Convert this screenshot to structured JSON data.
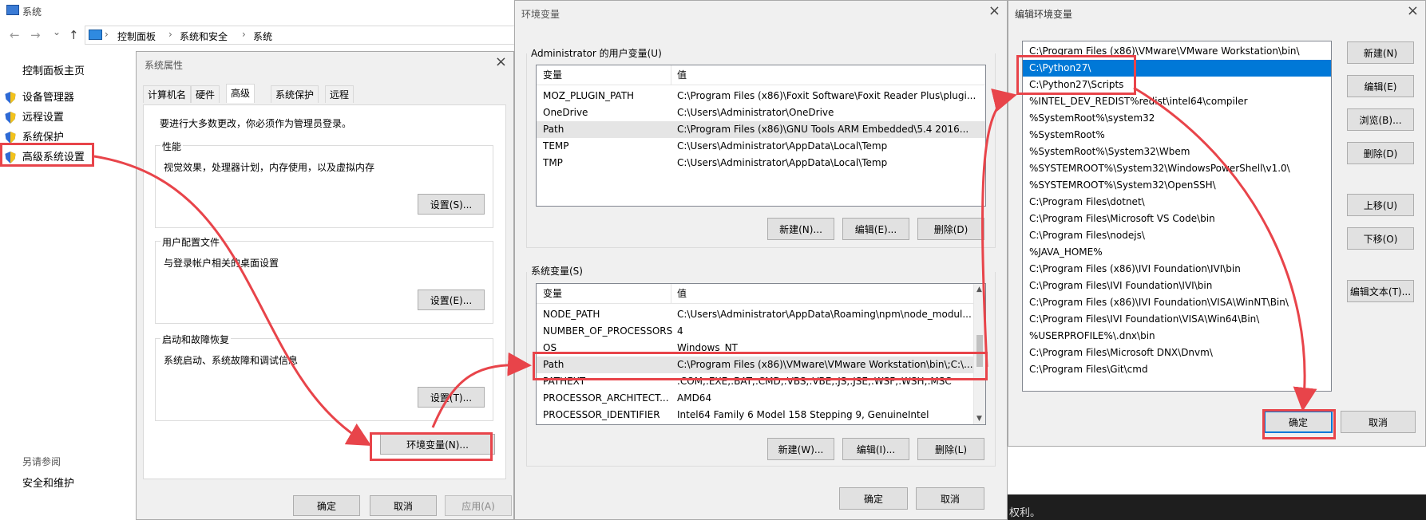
{
  "system_window": {
    "title": "系统",
    "breadcrumb": [
      "控制面板",
      "系统和安全",
      "系统"
    ],
    "nav_back": "←",
    "nav_forward": "→",
    "nav_dropdown": "⌄",
    "nav_up": "↑",
    "sidebar_home": "控制面板主页",
    "sidebar_items": [
      "设备管理器",
      "远程设置",
      "系统保护",
      "高级系统设置"
    ],
    "see_also_label": "另请参阅",
    "see_also_items": [
      "安全和维护"
    ]
  },
  "sys_props": {
    "title": "系统属性",
    "tabs": [
      "计算机名",
      "硬件",
      "高级",
      "系统保护",
      "远程"
    ],
    "active_tab": "高级",
    "admin_note": "要进行大多数更改，你必须作为管理员登录。",
    "groups": [
      {
        "label": "性能",
        "desc": "视觉效果，处理器计划，内存使用，以及虚拟内存",
        "button": "设置(S)..."
      },
      {
        "label": "用户配置文件",
        "desc": "与登录帐户相关的桌面设置",
        "button": "设置(E)..."
      },
      {
        "label": "启动和故障恢复",
        "desc": "系统启动、系统故障和调试信息",
        "button": "设置(T)..."
      }
    ],
    "env_button": "环境变量(N)...",
    "ok": "确定",
    "cancel": "取消",
    "apply": "应用(A)"
  },
  "env_vars": {
    "title": "环境变量",
    "user_section": "Administrator 的用户变量(U)",
    "col_var": "变量",
    "col_value": "值",
    "user_rows": [
      {
        "name": "MOZ_PLUGIN_PATH",
        "value": "C:\\Program Files (x86)\\Foxit Software\\Foxit Reader Plus\\plugi..."
      },
      {
        "name": "OneDrive",
        "value": "C:\\Users\\Administrator\\OneDrive"
      },
      {
        "name": "Path",
        "value": "C:\\Program Files (x86)\\GNU Tools ARM Embedded\\5.4 2016..."
      },
      {
        "name": "TEMP",
        "value": "C:\\Users\\Administrator\\AppData\\Local\\Temp"
      },
      {
        "name": "TMP",
        "value": "C:\\Users\\Administrator\\AppData\\Local\\Temp"
      }
    ],
    "user_buttons": [
      "新建(N)...",
      "编辑(E)...",
      "删除(D)"
    ],
    "system_section": "系统变量(S)",
    "system_rows": [
      {
        "name": "NODE_PATH",
        "value": "C:\\Users\\Administrator\\AppData\\Roaming\\npm\\node_modul..."
      },
      {
        "name": "NUMBER_OF_PROCESSORS",
        "value": "4"
      },
      {
        "name": "OS",
        "value": "Windows_NT"
      },
      {
        "name": "Path",
        "value": "C:\\Program Files (x86)\\VMware\\VMware Workstation\\bin\\;C:\\..."
      },
      {
        "name": "PATHEXT",
        "value": ".COM;.EXE;.BAT;.CMD;.VBS;.VBE;.JS;.JSE;.WSF;.WSH;.MSC"
      },
      {
        "name": "PROCESSOR_ARCHITECT...",
        "value": "AMD64"
      },
      {
        "name": "PROCESSOR_IDENTIFIER",
        "value": "Intel64 Family 6 Model 158 Stepping 9, GenuineIntel"
      }
    ],
    "system_buttons": [
      "新建(W)...",
      "编辑(I)...",
      "删除(L)"
    ],
    "ok": "确定",
    "cancel": "取消"
  },
  "edit_env": {
    "title": "编辑环境变量",
    "paths": [
      "C:\\Program Files (x86)\\VMware\\VMware Workstation\\bin\\",
      "C:\\Python27\\",
      "C:\\Python27\\Scripts",
      "%INTEL_DEV_REDIST%redist\\intel64\\compiler",
      "%SystemRoot%\\system32",
      "%SystemRoot%",
      "%SystemRoot%\\System32\\Wbem",
      "%SYSTEMROOT%\\System32\\WindowsPowerShell\\v1.0\\",
      "%SYSTEMROOT%\\System32\\OpenSSH\\",
      "C:\\Program Files\\dotnet\\",
      "C:\\Program Files\\Microsoft VS Code\\bin",
      "C:\\Program Files\\nodejs\\",
      "%JAVA_HOME%",
      "C:\\Program Files (x86)\\IVI Foundation\\IVI\\bin",
      "C:\\Program Files\\IVI Foundation\\IVI\\bin",
      "C:\\Program Files (x86)\\IVI Foundation\\VISA\\WinNT\\Bin\\",
      "C:\\Program Files\\IVI Foundation\\VISA\\Win64\\Bin\\",
      "%USERPROFILE%\\.dnx\\bin",
      "C:\\Program Files\\Microsoft DNX\\Dnvm\\",
      "C:\\Program Files\\Git\\cmd"
    ],
    "selected_index": 1,
    "buttons": [
      "新建(N)",
      "编辑(E)",
      "浏览(B)...",
      "删除(D)",
      "上移(U)",
      "下移(O)",
      "编辑文本(T)..."
    ],
    "ok": "确定",
    "cancel": "取消"
  },
  "background_text": "权利。",
  "colors": {
    "accent": "#0078d7",
    "annotation": "#e8444a"
  }
}
